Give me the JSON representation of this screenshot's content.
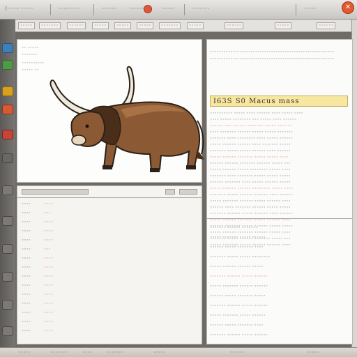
{
  "window": {
    "menu_items": [
      "[◦◦◦◦◦ ◦◦◦◦◦",
      "◦◦◦◦◦◦◦◦◦",
      "◦◦◦◦◦◦",
      "◦◦◦◦◦◦◦",
      "◦◦◦◦◦",
      "◦◦◦◦◦◦◦",
      "◦◦◦◦◦"
    ],
    "close_glyph": "✕"
  },
  "toolbar": {
    "items": [
      "◦◦◦◦◦",
      "◦◦◦◦◦◦◦",
      "◦◦◦◦◦◦",
      "◦◦◦◦◦",
      "◦◦◦◦◦",
      "◦◦◦◦◦",
      "◦◦◦◦◦◦◦",
      "◦◦◦◦◦",
      "◦◦◦◦◦◦",
      "◦◦◦◦◦",
      "◦◦◦◦◦◦"
    ]
  },
  "left_top": {
    "lines": [
      "◦◦ ◦◦◦◦◦",
      "◦◦◦◦◦◦◦",
      "◦◦◦◦◦◦◦◦◦◦",
      "◦◦◦◦◦ ◦◦"
    ],
    "image_alt": "bull illustration"
  },
  "left_bottom": {
    "labels": [
      "◦◦◦◦",
      "◦◦◦◦",
      "◦◦◦◦",
      "◦◦◦◦",
      "◦◦◦◦",
      "◦◦◦◦",
      "◦◦◦◦",
      "◦◦◦◦",
      "◦◦◦◦",
      "◦◦◦◦",
      "◦◦◦◦",
      "◦◦◦◦",
      "◦◦◦◦",
      "◦◦◦◦",
      "◦◦◦◦"
    ],
    "values": [
      "◦◦◦◦",
      "◦◦◦",
      "◦◦◦◦",
      "◦◦◦◦",
      "◦◦◦◦",
      "◦◦◦",
      "◦◦◦◦",
      "◦◦◦◦",
      "◦◦◦◦",
      "◦◦◦◦",
      "◦◦◦◦",
      "◦◦◦◦",
      "◦◦◦◦",
      "◦◦◦◦",
      "◦◦◦◦"
    ]
  },
  "right": {
    "header_text": "I63S S0 Macus mass",
    "top_lines": [
      "◦◦◦◦◦◦◦◦◦◦◦◦◦◦◦◦◦◦◦◦◦◦◦◦◦◦◦◦◦◦◦◦◦◦◦◦◦◦◦◦◦◦◦◦◦◦◦◦◦◦◦◦◦◦◦",
      "◦◦◦◦◦◦◦◦◦◦◦◦◦◦◦◦◦◦◦◦◦◦◦◦◦◦◦◦◦◦◦◦◦◦◦◦◦◦◦◦◦◦◦◦◦◦◦◦◦◦◦◦◦◦◦"
    ],
    "rows": [
      "◦◦◦◦◦◦◦◦◦◦ ◦◦◦◦◦ ◦◦◦◦ ◦◦◦◦◦◦ ◦◦◦◦ ◦◦◦◦◦ ◦◦◦◦",
      "◦◦◦◦ ◦◦◦◦◦ ◦◦◦◦◦◦◦◦ ◦◦◦ ◦◦◦◦◦ ◦◦◦◦ ◦◦◦◦◦◦",
      "◦◦◦◦◦◦ ◦◦◦ ◦◦◦◦◦◦ ◦◦◦◦◦◦◦ ◦◦◦◦◦ ◦◦◦◦ ◦◦",
      "◦◦◦◦ ◦◦◦◦◦◦◦ ◦◦◦◦◦◦ ◦◦◦◦◦ ◦◦◦◦◦ ◦◦◦◦◦◦◦",
      "◦◦◦◦◦◦◦ ◦◦◦◦ ◦◦◦◦◦◦◦◦ ◦◦◦◦ ◦◦◦◦◦ ◦◦◦◦◦◦",
      "◦◦◦◦◦ ◦◦◦◦◦◦ ◦◦◦◦◦◦ ◦◦◦◦ ◦◦◦◦◦◦◦ ◦◦◦◦◦",
      "◦◦◦◦◦◦◦ ◦◦◦◦◦ ◦◦◦◦◦ ◦◦◦◦◦◦ ◦◦◦◦ ◦◦◦◦◦◦",
      "◦◦◦◦◦ ◦◦◦◦◦◦ ◦◦◦◦◦◦◦ ◦◦◦◦◦ ◦◦◦◦◦ ◦◦◦◦",
      "◦◦◦◦◦◦ ◦◦◦◦◦◦ ◦◦◦◦◦◦◦ ◦◦◦◦◦◦ ◦◦◦◦◦ ◦◦◦",
      "◦◦◦◦◦ ◦◦◦◦◦◦ ◦◦◦◦◦ ◦◦◦◦◦◦◦◦ ◦◦◦◦◦ ◦◦◦◦",
      "◦◦◦◦◦◦◦ ◦◦◦◦ ◦◦◦◦◦◦◦ ◦◦◦◦◦ ◦◦◦◦◦ ◦◦◦◦◦",
      "◦◦◦◦◦◦ ◦◦◦◦◦◦◦ ◦◦◦◦ ◦◦◦◦◦ ◦◦◦◦◦◦ ◦◦◦◦◦",
      "◦◦◦◦◦ ◦◦◦◦◦◦ ◦◦◦◦◦◦ ◦◦◦◦◦◦◦◦ ◦◦◦◦◦ ◦◦◦◦",
      "◦◦◦◦◦◦◦ ◦◦◦◦◦ ◦◦◦◦◦◦ ◦◦◦◦◦◦ ◦◦◦◦ ◦◦◦◦◦◦",
      "◦◦◦◦◦ ◦◦◦◦◦◦◦ ◦◦◦◦◦◦ ◦◦◦◦◦ ◦◦◦◦◦◦ ◦◦◦◦",
      "◦◦◦◦◦◦ ◦◦◦◦ ◦◦◦◦◦◦◦ ◦◦◦◦◦◦ ◦◦◦◦◦ ◦◦◦◦◦",
      "◦◦◦◦◦◦◦ ◦◦◦◦◦◦ ◦◦◦◦◦ ◦◦◦◦◦◦ ◦◦◦◦ ◦◦◦◦◦◦",
      "◦◦◦◦◦ ◦◦◦◦◦◦ ◦◦◦◦◦◦◦ ◦◦◦◦◦ ◦◦◦◦◦◦ ◦◦◦◦",
      "◦◦◦◦◦◦ ◦◦◦◦◦◦◦ ◦◦◦◦◦ ◦◦◦◦◦◦ ◦◦◦◦◦ ◦◦◦◦◦",
      "◦◦◦◦◦ ◦◦◦◦◦◦ ◦◦◦◦◦◦◦ ◦◦◦◦◦◦ ◦◦◦◦◦ ◦◦◦◦",
      "◦◦◦◦◦◦◦ ◦◦◦◦◦ ◦◦◦◦◦◦ ◦◦◦◦◦◦◦ ◦◦◦◦◦ ◦◦◦",
      "◦◦◦◦◦ ◦◦◦◦◦◦◦ ◦◦◦◦◦ ◦◦◦◦◦◦ ◦◦◦◦◦◦ ◦◦◦◦"
    ],
    "bottom_lines": [
      "◦◦◦◦◦◦◦ ◦◦◦◦◦◦ ◦◦◦◦◦◦◦",
      "◦◦◦◦◦ ◦◦◦◦◦◦◦ ◦◦◦◦◦ ◦◦◦◦◦◦",
      "◦◦◦◦◦◦ ◦◦◦◦◦ ◦◦◦◦◦◦◦ ◦◦◦◦",
      "◦◦◦◦◦◦◦ ◦◦◦◦◦ ◦◦◦◦◦ ◦◦◦◦◦◦◦◦",
      "◦◦◦◦◦ ◦◦◦◦◦◦ ◦◦◦◦◦◦ ◦◦◦◦◦",
      "◦◦◦◦◦◦◦ ◦◦◦◦◦◦ ◦◦◦◦◦ ◦◦◦◦◦◦",
      "◦◦◦◦◦ ◦◦◦◦◦◦◦ ◦◦◦◦◦◦ ◦◦◦◦◦◦",
      "◦◦◦◦◦◦ ◦◦◦◦◦ ◦◦◦◦◦◦◦ ◦◦◦◦◦",
      "◦◦◦◦◦◦◦ ◦◦◦◦◦◦ ◦◦◦◦◦ ◦◦◦◦◦◦",
      "◦◦◦◦◦ ◦◦◦◦◦◦◦ ◦◦◦◦◦ ◦◦◦◦◦◦",
      "◦◦◦◦◦◦ ◦◦◦◦◦ ◦◦◦◦◦◦◦ ◦◦◦◦",
      "◦◦◦◦◦◦◦ ◦◦◦◦◦◦ ◦◦◦◦◦ ◦◦◦◦◦◦"
    ]
  },
  "status": {
    "items": [
      "◦◦◦◦◦",
      "◦◦◦◦◦◦◦",
      "◦◦◦◦",
      "◦◦◦◦◦◦◦",
      "◦◦◦◦◦",
      "◦◦◦◦◦◦",
      "◦◦◦◦◦"
    ]
  },
  "colors": {
    "accent_red": "#c94428",
    "header_yellow": "#f7e7a0"
  }
}
